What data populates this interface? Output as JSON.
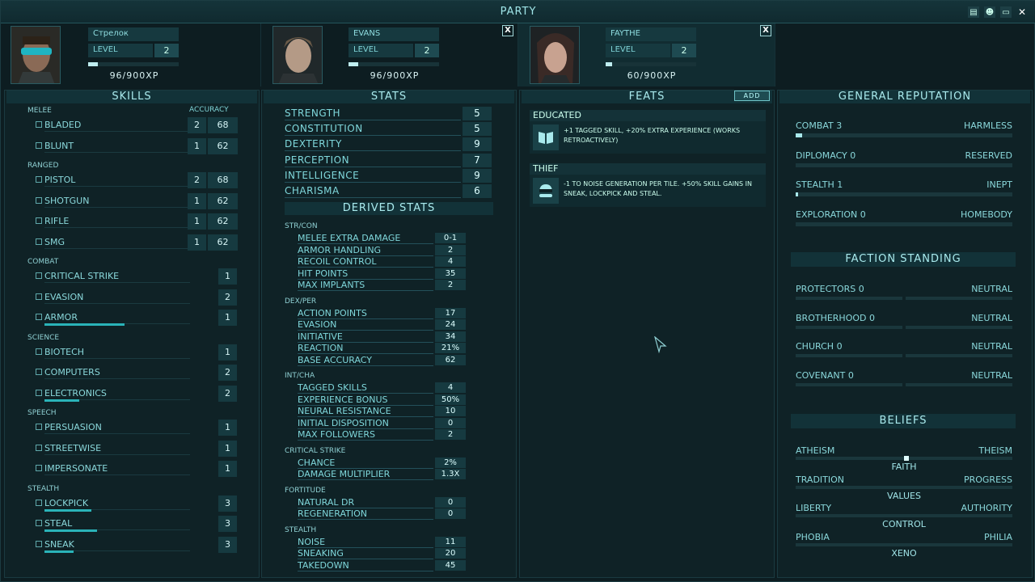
{
  "window": {
    "title": "PARTY"
  },
  "party": [
    {
      "name": "Стрелок",
      "level_label": "LEVEL",
      "level": "2",
      "xp": "96/900XP",
      "xp_frac": 0.11
    },
    {
      "name": "EVANS",
      "level_label": "LEVEL",
      "level": "2",
      "xp": "96/900XP",
      "xp_frac": 0.11
    },
    {
      "name": "FAYTHE",
      "level_label": "LEVEL",
      "level": "2",
      "xp": "60/900XP",
      "xp_frac": 0.07
    }
  ],
  "skills": {
    "title": "SKILLS",
    "accuracy_label": "ACCURACY",
    "categories": [
      {
        "name": "MELEE",
        "items": [
          {
            "name": "BLADED",
            "value": "2",
            "accuracy": "68",
            "progress": 0
          },
          {
            "name": "BLUNT",
            "value": "1",
            "accuracy": "62",
            "progress": 0
          }
        ]
      },
      {
        "name": "RANGED",
        "items": [
          {
            "name": "PISTOL",
            "value": "2",
            "accuracy": "68",
            "progress": 0
          },
          {
            "name": "SHOTGUN",
            "value": "1",
            "accuracy": "62",
            "progress": 0
          },
          {
            "name": "RIFLE",
            "value": "1",
            "accuracy": "62",
            "progress": 0
          },
          {
            "name": "SMG",
            "value": "1",
            "accuracy": "62",
            "progress": 0
          }
        ]
      },
      {
        "name": "COMBAT",
        "items": [
          {
            "name": "CRITICAL STRIKE",
            "value": "1",
            "progress": 0
          },
          {
            "name": "EVASION",
            "value": "2",
            "progress": 0
          },
          {
            "name": "ARMOR",
            "value": "1",
            "progress": 0.55
          }
        ]
      },
      {
        "name": "SCIENCE",
        "items": [
          {
            "name": "BIOTECH",
            "value": "1",
            "progress": 0
          },
          {
            "name": "COMPUTERS",
            "value": "2",
            "progress": 0
          },
          {
            "name": "ELECTRONICS",
            "value": "2",
            "progress": 0.24
          }
        ]
      },
      {
        "name": "SPEECH",
        "items": [
          {
            "name": "PERSUASION",
            "value": "1",
            "progress": 0
          },
          {
            "name": "STREETWISE",
            "value": "1",
            "progress": 0
          },
          {
            "name": "IMPERSONATE",
            "value": "1",
            "progress": 0
          }
        ]
      },
      {
        "name": "STEALTH",
        "items": [
          {
            "name": "LOCKPICK",
            "value": "3",
            "progress": 0.32
          },
          {
            "name": "STEAL",
            "value": "3",
            "progress": 0.36
          },
          {
            "name": "SNEAK",
            "value": "3",
            "progress": 0.2
          }
        ]
      }
    ]
  },
  "stats": {
    "title": "STATS",
    "items": [
      {
        "name": "STRENGTH",
        "value": "5"
      },
      {
        "name": "CONSTITUTION",
        "value": "5"
      },
      {
        "name": "DEXTERITY",
        "value": "9"
      },
      {
        "name": "PERCEPTION",
        "value": "7"
      },
      {
        "name": "INTELLIGENCE",
        "value": "9"
      },
      {
        "name": "CHARISMA",
        "value": "6"
      }
    ],
    "derived_title": "DERIVED STATS",
    "derived": [
      {
        "name": "STR/CON",
        "items": [
          {
            "name": "MELEE EXTRA DAMAGE",
            "value": "0-1"
          },
          {
            "name": "ARMOR HANDLING",
            "value": "2"
          },
          {
            "name": "RECOIL CONTROL",
            "value": "4"
          },
          {
            "name": "HIT POINTS",
            "value": "35"
          },
          {
            "name": "MAX IMPLANTS",
            "value": "2"
          }
        ]
      },
      {
        "name": "DEX/PER",
        "items": [
          {
            "name": "ACTION POINTS",
            "value": "17"
          },
          {
            "name": "EVASION",
            "value": "24"
          },
          {
            "name": "INITIATIVE",
            "value": "34"
          },
          {
            "name": "REACTION",
            "value": "21%"
          },
          {
            "name": "BASE ACCURACY",
            "value": "62"
          }
        ]
      },
      {
        "name": "INT/CHA",
        "items": [
          {
            "name": "TAGGED SKILLS",
            "value": "4"
          },
          {
            "name": "EXPERIENCE BONUS",
            "value": "50%"
          },
          {
            "name": "NEURAL RESISTANCE",
            "value": "10"
          },
          {
            "name": "INITIAL DISPOSITION",
            "value": "0"
          },
          {
            "name": "MAX FOLLOWERS",
            "value": "2"
          }
        ]
      },
      {
        "name": "CRITICAL STRIKE",
        "items": [
          {
            "name": "CHANCE",
            "value": "2%"
          },
          {
            "name": "DAMAGE MULTIPLIER",
            "value": "1.3x"
          }
        ]
      },
      {
        "name": "FORTITUDE",
        "items": [
          {
            "name": "NATURAL DR",
            "value": "0"
          },
          {
            "name": "REGENERATION",
            "value": "0"
          }
        ]
      },
      {
        "name": "STEALTH",
        "items": [
          {
            "name": "NOISE",
            "value": "11"
          },
          {
            "name": "SNEAKING",
            "value": "20"
          },
          {
            "name": "TAKEDOWN",
            "value": "45"
          }
        ]
      }
    ]
  },
  "feats": {
    "title": "FEATS",
    "add_label": "ADD",
    "items": [
      {
        "name": "EDUCATED",
        "desc": "+1 TAGGED SKILL, +20% EXTRA EXPERIENCE (WORKS RETROACTIVELY)",
        "icon": "book-icon"
      },
      {
        "name": "THIEF",
        "desc": "-1 TO NOISE GENERATION PER TILE. +50% SKILL GAINS IN SNEAK, LOCKPICK AND STEAL.",
        "icon": "masked-thief-icon"
      }
    ]
  },
  "reputation": {
    "title": "GENERAL REPUTATION",
    "items": [
      {
        "name": "COMBAT",
        "value": "3",
        "status": "HARMLESS",
        "frac": 0.03
      },
      {
        "name": "DIPLOMACY",
        "value": "0",
        "status": "RESERVED",
        "frac": 0
      },
      {
        "name": "STEALTH",
        "value": "1",
        "status": "INEPT",
        "frac": 0.01
      },
      {
        "name": "EXPLORATION",
        "value": "0",
        "status": "HOMEBODY",
        "frac": 0
      }
    ]
  },
  "factions": {
    "title": "FACTION STANDING",
    "items": [
      {
        "name": "PROTECTORS",
        "value": "0",
        "status": "NEUTRAL"
      },
      {
        "name": "BROTHERHOOD",
        "value": "0",
        "status": "NEUTRAL"
      },
      {
        "name": "CHURCH",
        "value": "0",
        "status": "NEUTRAL"
      },
      {
        "name": "COVENANT",
        "value": "0",
        "status": "NEUTRAL"
      }
    ]
  },
  "beliefs": {
    "title": "BELIEFS",
    "items": [
      {
        "left": "ATHEISM",
        "right": "THEISM",
        "center": "FAITH",
        "pos": 0.51
      },
      {
        "left": "TRADITION",
        "right": "PROGRESS",
        "center": "VALUES",
        "pos": null
      },
      {
        "left": "LIBERTY",
        "right": "AUTHORITY",
        "center": "CONTROL",
        "pos": null
      },
      {
        "left": "PHOBIA",
        "right": "PHILIA",
        "center": "XENO",
        "pos": null
      }
    ]
  },
  "colors": {
    "accent": "#7fd3d6",
    "panel": "#0f2226",
    "bar_fill": "#2ab3b8"
  }
}
